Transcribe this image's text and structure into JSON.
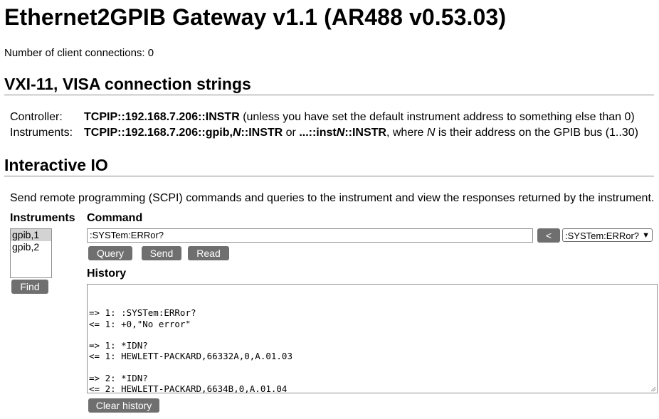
{
  "page": {
    "title": "Ethernet2GPIB Gateway v1.1 (AR488 v0.53.03)",
    "client_connections": "Number of client connections: 0"
  },
  "vxi": {
    "heading": "VXI-11, VISA connection strings",
    "controller": {
      "label": "Controller:",
      "string": "TCPIP::192.168.7.206::INSTR",
      "note": " (unless you have set the default instrument address to something else than 0)"
    },
    "instruments": {
      "label": "Instruments:",
      "s1": "TCPIP::192.168.7.206::gpib,",
      "n1": "N",
      "s2": "::INSTR",
      "or": " or ",
      "s3": "...::inst",
      "n2": "N",
      "s4": "::INSTR",
      "where": ", where ",
      "n3": "N",
      "tail": " is their address on the GPIB bus (1..30)"
    }
  },
  "interactive": {
    "heading": "Interactive IO",
    "description": "Send remote programming (SCPI) commands and queries to the instrument and view the responses returned by the instrument.",
    "instruments_label": "Instruments",
    "instrument_list": [
      "gpib,1",
      "gpib,2"
    ],
    "selected_instrument": "gpib,1",
    "find_label": "Find",
    "command_label": "Command",
    "command_value": ":SYSTem:ERRor?",
    "prev_label": "<",
    "history_select": ":SYSTem:ERRor?",
    "query_label": "Query",
    "send_label": "Send",
    "read_label": "Read",
    "history_label": "History",
    "history_lines": [
      "=> 1: :SYSTem:ERRor?",
      "<= 1: +0,\"No error\"",
      "",
      "=> 1: *IDN?",
      "<= 1: HEWLETT-PACKARD,66332A,0,A.01.03",
      "",
      "=> 2: *IDN?",
      "<= 2: HEWLETT-PACKARD,6634B,0,A.01.04"
    ],
    "clear_label": "Clear history"
  }
}
